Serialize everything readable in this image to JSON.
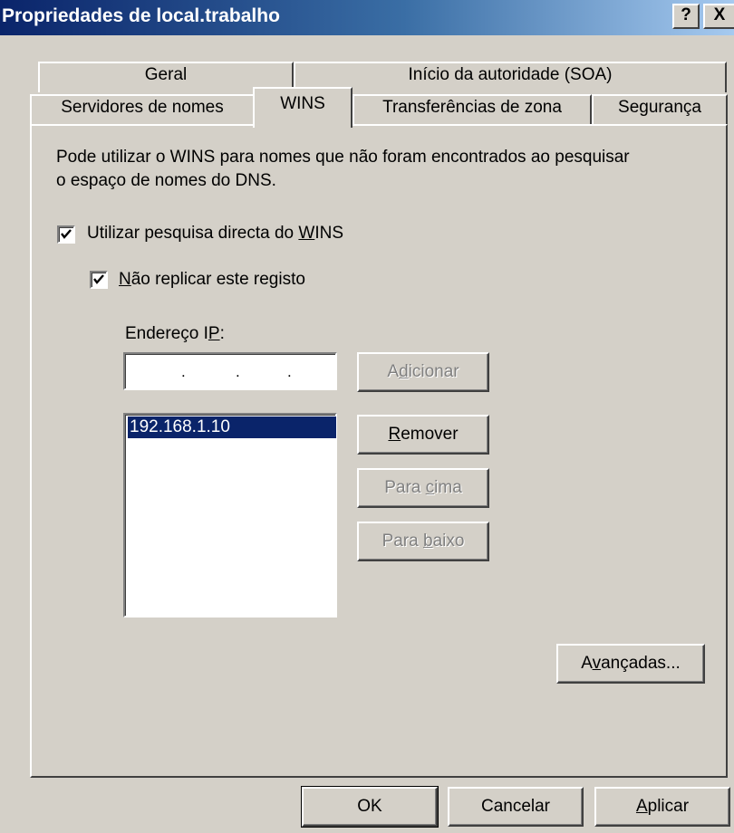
{
  "window": {
    "title": "Propriedades de local.trabalho",
    "help_glyph": "?",
    "close_glyph": "X"
  },
  "tabs": {
    "row1": [
      "Geral",
      "Início da autoridade (SOA)"
    ],
    "row2": [
      "Servidores de nomes",
      "WINS",
      "Transferências de zona",
      "Segurança"
    ],
    "active": "WINS"
  },
  "wins": {
    "description_line1": "Pode utilizar o WINS para nomes que não foram encontrados ao pesquisar",
    "description_line2": "o espaço de nomes do DNS.",
    "use_wins": {
      "label_pre": "Utilizar pesquisa directa do ",
      "label_mnemonic": "W",
      "label_post": "INS",
      "checked": true
    },
    "no_replicate": {
      "label_pre": "",
      "label_mnemonic": "N",
      "label_post": "ão replicar este registo",
      "checked": true
    },
    "ip_label": {
      "pre": "Endereço I",
      "mnemonic": "P",
      "post": ":"
    },
    "ip_input_value": ". . .",
    "ip_list": [
      "192.168.1.10"
    ],
    "buttons": {
      "add": {
        "pre": "A",
        "mnemonic": "d",
        "post": "icionar",
        "enabled": false
      },
      "remove": {
        "pre": "",
        "mnemonic": "R",
        "post": "emover",
        "enabled": true
      },
      "up": {
        "pre": "Para ",
        "mnemonic": "c",
        "post": "ima",
        "enabled": false
      },
      "down": {
        "pre": "Para ",
        "mnemonic": "b",
        "post": "aixo",
        "enabled": false
      },
      "advanced": {
        "pre": "A",
        "mnemonic": "v",
        "post": "ançadas...",
        "enabled": true
      }
    }
  },
  "footer": {
    "ok": "OK",
    "cancel": "Cancelar",
    "apply": {
      "pre": "",
      "mnemonic": "A",
      "post": "plicar"
    }
  },
  "colors": {
    "face": "#d4d0c8",
    "title_start": "#0a246a",
    "title_end": "#a6caf0",
    "selection": "#0a246a"
  }
}
